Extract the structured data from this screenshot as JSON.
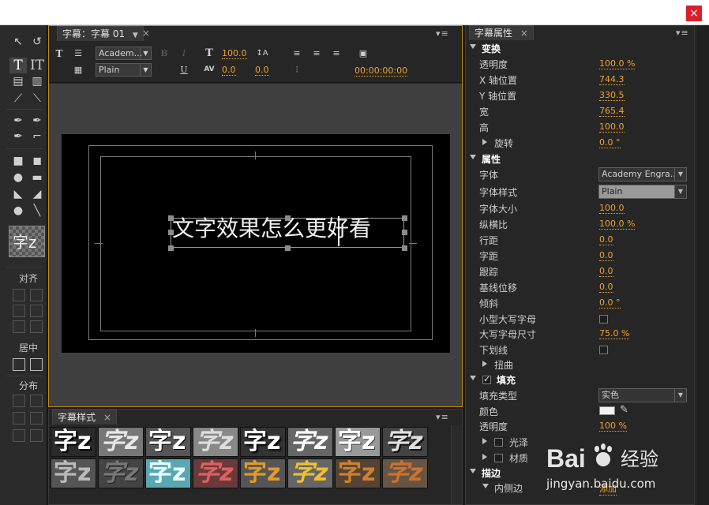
{
  "window": {
    "close_glyph": "×"
  },
  "left_tools": {
    "align_label": "对齐",
    "center_label": "居中",
    "distribute_label": "分布",
    "preview_glyph": "字z"
  },
  "title_panel": {
    "tab_label": "字幕：字幕 01",
    "tab_close": "×",
    "menu_glyph": "▾≡",
    "font_family": "Academ...",
    "font_style": "Plain",
    "bold_glyph": "B",
    "italic_glyph": "I",
    "underline_glyph": "U",
    "font_size": "100.0",
    "leading": "0.0",
    "kerning": "0.0",
    "timecode": "00:00:00:00",
    "canvas_text": "文字效果怎么更好看"
  },
  "styles_panel": {
    "tab_label": "字幕样式",
    "tab_close": "×",
    "menu_glyph": "▾≡",
    "swatch_glyph": "字z"
  },
  "properties": {
    "tab_label": "字幕属性",
    "tab_close": "×",
    "menu_glyph": "▾≡",
    "transform": "变换",
    "opacity_label": "透明度",
    "opacity": "100.0 %",
    "xpos_label": "X 轴位置",
    "xpos": "744.3",
    "ypos_label": "Y 轴位置",
    "ypos": "330.5",
    "width_label": "宽",
    "width": "765.4",
    "height_label": "高",
    "height": "100.0",
    "rotation_label": "旋转",
    "rotation": "0.0 °",
    "properties": "属性",
    "font_label": "字体",
    "font": "Academy Engra...",
    "style_label": "字体样式",
    "style": "Plain",
    "size_label": "字体大小",
    "size": "100.0",
    "aspect_label": "纵横比",
    "aspect": "100.0 %",
    "leading_label": "行距",
    "leading": "0.0",
    "kerning_label": "字距",
    "kerning": "0.0",
    "tracking_label": "跟踪",
    "tracking": "0.0",
    "baseline_label": "基线位移",
    "baseline": "0.0",
    "slant_label": "倾斜",
    "slant": "0.0 °",
    "smallcaps_label": "小型大写字母",
    "smallcaps_size_label": "大写字母尺寸",
    "smallcaps_size": "75.0 %",
    "underline_label": "下划线",
    "distort_label": "扭曲",
    "fill": "填充",
    "fill_type_label": "填充类型",
    "fill_type": "实色",
    "color_label": "颜色",
    "fill_color": "#f2f2f2",
    "fill_opacity_label": "透明度",
    "fill_opacity": "100 %",
    "sheen_label": "光泽",
    "texture_label": "材质",
    "stroke": "描边",
    "inner_stroke_label": "内侧边",
    "inner_stroke_add": "添加"
  },
  "watermark": {
    "brand": "Bai",
    "brand2": "经验",
    "url": "jingyan.baidu.com"
  },
  "colors": {
    "accent": "#f0a32a",
    "panel": "#262626",
    "active_border": "#c38a1d",
    "close": "#d9202a"
  }
}
